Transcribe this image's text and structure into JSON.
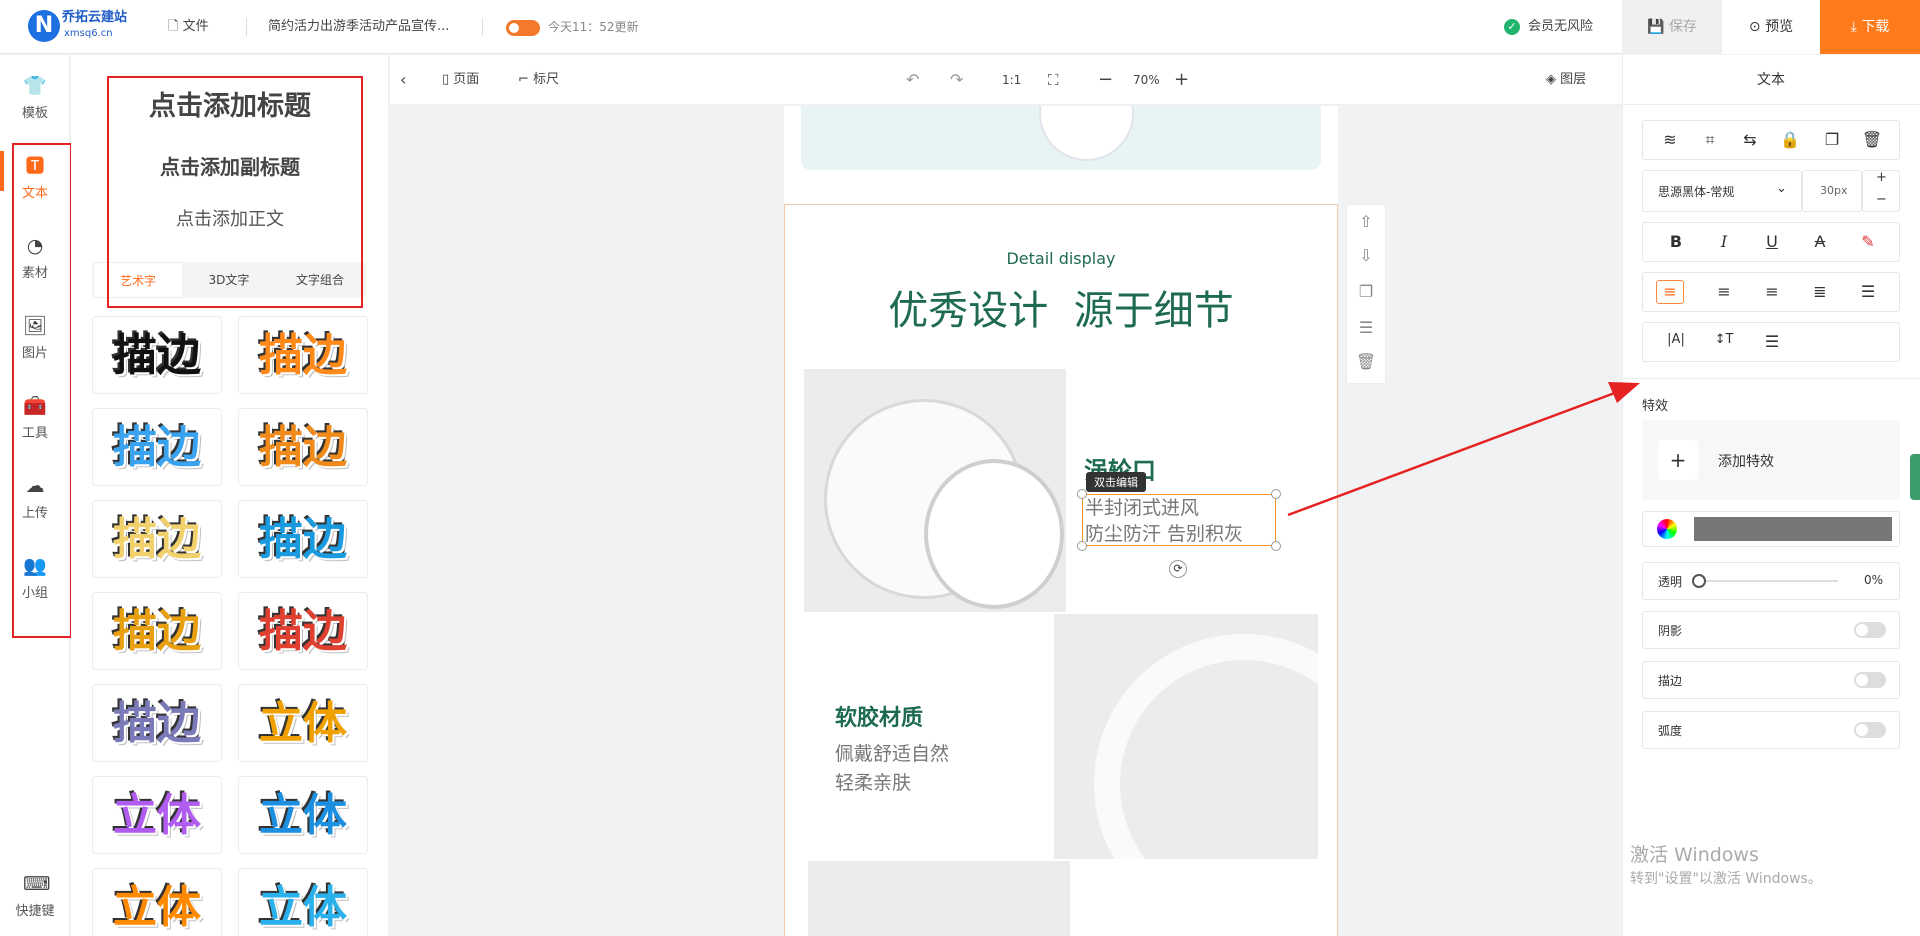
{
  "brand": {
    "name": "乔拓云建站",
    "domain": "xmsq6.cn",
    "logo_letter": "N"
  },
  "topbar": {
    "file_label": "文件",
    "doc_title": "简约活力出游季活动产品宣传...",
    "autosave_text": "今天11：52更新",
    "member_text": "会员无风险",
    "save_label": "保存",
    "preview_label": "预览",
    "download_label": "下载"
  },
  "rail": {
    "items": [
      {
        "label": "模板",
        "icon": "shirt-icon"
      },
      {
        "label": "文本",
        "icon": "text-icon"
      },
      {
        "label": "素材",
        "icon": "shapes-icon"
      },
      {
        "label": "图片",
        "icon": "image-icon"
      },
      {
        "label": "工具",
        "icon": "toolbox-icon"
      },
      {
        "label": "上传",
        "icon": "cloud-upload-icon"
      },
      {
        "label": "小组",
        "icon": "group-icon"
      }
    ],
    "shortcut_label": "快捷键",
    "active": "文本"
  },
  "text_panel": {
    "add_title": "点击添加标题",
    "add_subtitle": "点击添加副标题",
    "add_body": "点击添加正文",
    "tabs": [
      "艺术字",
      "3D文字",
      "文字组合"
    ],
    "active_tab": "艺术字",
    "art_samples": [
      {
        "text": "描边",
        "color": "#111111"
      },
      {
        "text": "描边",
        "color": "#ff8a1a"
      },
      {
        "text": "描边",
        "color": "#3aa3f0"
      },
      {
        "text": "描边",
        "color": "#f08a1a"
      },
      {
        "text": "描边",
        "color": "#f2d06b"
      },
      {
        "text": "描边",
        "color": "#1a9be0"
      },
      {
        "text": "描边",
        "color": "#e8a010"
      },
      {
        "text": "描边",
        "color": "#e04030"
      },
      {
        "text": "描边",
        "color": "#7a7ab8"
      },
      {
        "text": "立体",
        "color": "#f0a000"
      },
      {
        "text": "立体",
        "color": "#b05cf0"
      },
      {
        "text": "立体",
        "color": "#1c8fe0"
      },
      {
        "text": "立体",
        "color": "#ff8a00"
      },
      {
        "text": "立体",
        "color": "#2ab0ea"
      }
    ]
  },
  "canvas_toolbar": {
    "page_label": "页面",
    "ruler_label": "标尺",
    "ratio_label": "1:1",
    "zoom": "70%",
    "layers_label": "图层"
  },
  "design": {
    "en_heading": "Detail display",
    "heading": "优秀设计  源于细节",
    "feature1_title": "涡轮口",
    "feature1_line1": "半封闭式进风",
    "feature1_line2": "防尘防汗 告别积灰",
    "edit_tip": "双击编辑",
    "feature2_title": "软胶材质",
    "feature2_line1": "佩戴舒适自然",
    "feature2_line2": "轻柔亲肤"
  },
  "right_panel": {
    "title": "文本",
    "font_family": "思源黑体-常规",
    "font_size": "30px",
    "effects_label": "特效",
    "add_effect_label": "添加特效",
    "opacity_label": "透明",
    "opacity_value": "0%",
    "shadow_label": "阴影",
    "stroke_label": "描边",
    "curve_label": "弧度"
  },
  "watermark": {
    "line1": "激活 Windows",
    "line2": "转到\"设置\"以激活 Windows。"
  },
  "colors": {
    "accent": "#ff6a1a",
    "heading_green": "#1e6b4f",
    "annotation_red": "#e52222"
  }
}
